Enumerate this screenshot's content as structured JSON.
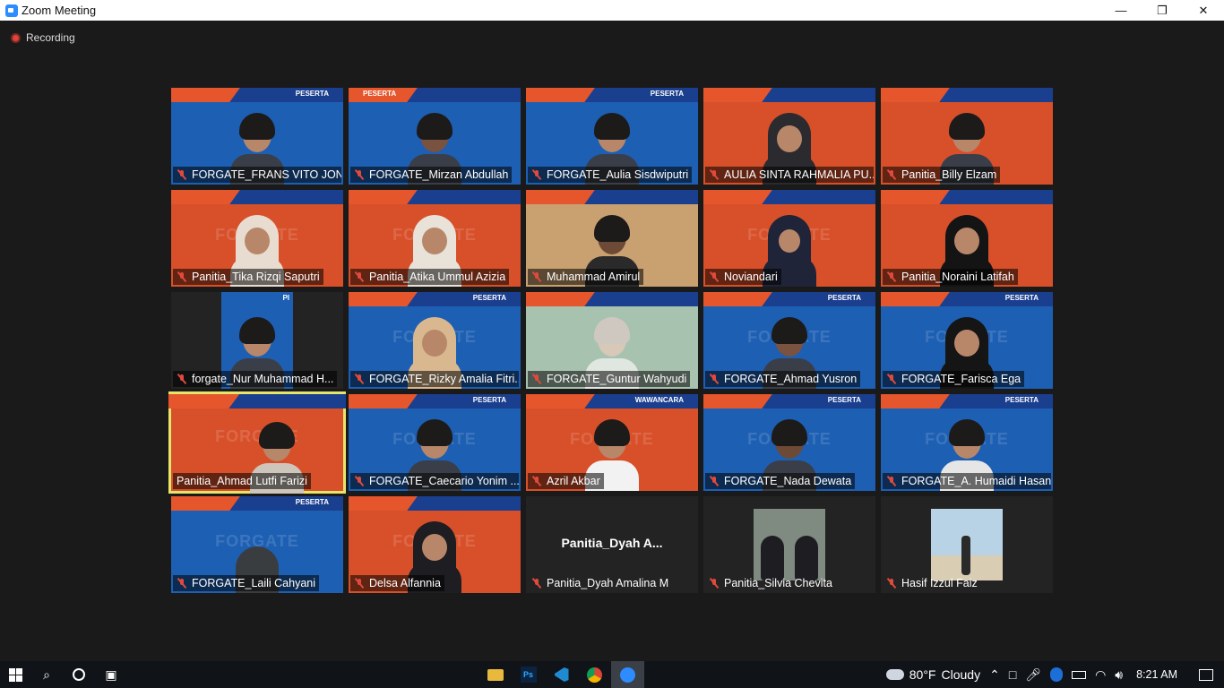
{
  "window": {
    "title": "Zoom Meeting",
    "minimize": "—",
    "maximize": "❐",
    "close": "✕"
  },
  "recording": {
    "label": "Recording"
  },
  "tiles": [
    {
      "name": "FORGATE_FRANS VITO JON...",
      "tag": "PESERTA",
      "muted": true
    },
    {
      "name": "FORGATE_Mirzan Abdullah",
      "tag": "PESERTA",
      "muted": true
    },
    {
      "name": "FORGATE_Aulia Sisdwiputri",
      "tag": "PESERTA",
      "muted": true
    },
    {
      "name": "AULIA SINTA RAHMALIA PU...",
      "tag": "",
      "muted": true
    },
    {
      "name": "Panitia_Billy Elzam",
      "tag": "",
      "muted": true
    },
    {
      "name": "Panitia_Tika Rizqi Saputri",
      "tag": "",
      "muted": true
    },
    {
      "name": "Panitia_Atika Ummul Azizia",
      "tag": "",
      "muted": true
    },
    {
      "name": "Muhammad Amirul",
      "tag": "",
      "muted": true
    },
    {
      "name": "Noviandari",
      "tag": "",
      "muted": true
    },
    {
      "name": "Panitia_Noraini Latifah",
      "tag": "",
      "muted": true
    },
    {
      "name": "forgate_Nur Muhammad H...",
      "tag": "PI",
      "muted": true
    },
    {
      "name": "FORGATE_Rizky Amalia Fitri...",
      "tag": "PESERTA",
      "muted": true
    },
    {
      "name": "FORGATE_Guntur Wahyudi",
      "tag": "",
      "muted": true
    },
    {
      "name": "FORGATE_Ahmad Yusron",
      "tag": "PESERTA",
      "muted": true
    },
    {
      "name": "FORGATE_Farisca Ega",
      "tag": "PESERTA",
      "muted": true
    },
    {
      "name": "Panitia_Ahmad Lutfi Farizi",
      "tag": "",
      "muted": false
    },
    {
      "name": "FORGATE_Caecario Yonim ...",
      "tag": "PESERTA",
      "muted": true
    },
    {
      "name": "Azril Akbar",
      "tag": "WAWANCARA",
      "muted": true
    },
    {
      "name": "FORGATE_Nada Dewata",
      "tag": "PESERTA",
      "muted": true
    },
    {
      "name": "FORGATE_A. Humaidi Hasani",
      "tag": "PESERTA",
      "muted": true
    },
    {
      "name": "FORGATE_Laili Cahyani",
      "tag": "PESERTA",
      "muted": true
    },
    {
      "name": "Delsa Alfannia",
      "tag": "",
      "muted": true
    },
    {
      "name": "Panitia_Dyah Amalina M",
      "tag": "",
      "muted": true,
      "center_label": "Panitia_Dyah  A..."
    },
    {
      "name": "Panitia_Silvia Chevita",
      "tag": "",
      "muted": true
    },
    {
      "name": "Hasif Izzul Faiz",
      "tag": "",
      "muted": true
    }
  ],
  "taskbar": {
    "weather_temp": "80°F",
    "weather_desc": "Cloudy",
    "time": "8:21 AM",
    "ps_label": "Ps"
  }
}
